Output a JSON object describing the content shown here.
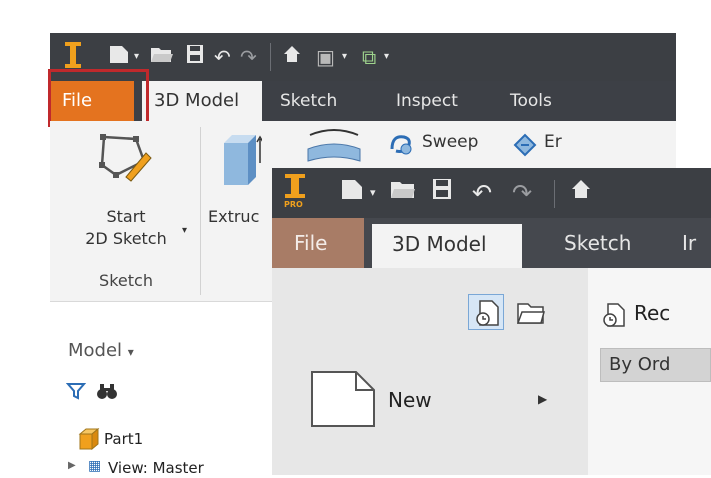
{
  "back_window": {
    "tabs": {
      "file": "File",
      "model": "3D Model",
      "sketch": "Sketch",
      "inspect": "Inspect",
      "tools": "Tools"
    },
    "ribbon": {
      "sweep_label": "Sweep",
      "emboss_label": "Er",
      "start_label_1": "Start",
      "start_label_2": "2D Sketch",
      "extrude_label": "Extruc",
      "panel_label": "Sketch"
    },
    "browser": {
      "title": "Model",
      "part_label": "Part1",
      "view_label": "View: Master"
    },
    "accent_file": "#e4731f",
    "highlight_border": "#c0292c"
  },
  "front_window": {
    "logo_text": "PRO",
    "tabs": {
      "file": "File",
      "model": "3D Model",
      "sketch": "Sketch",
      "partial": "Ir"
    },
    "menu": {
      "new_label": "New"
    },
    "recent": {
      "title": "Rec",
      "sort_label": "By Ord"
    },
    "accent_file": "#a87c66"
  }
}
